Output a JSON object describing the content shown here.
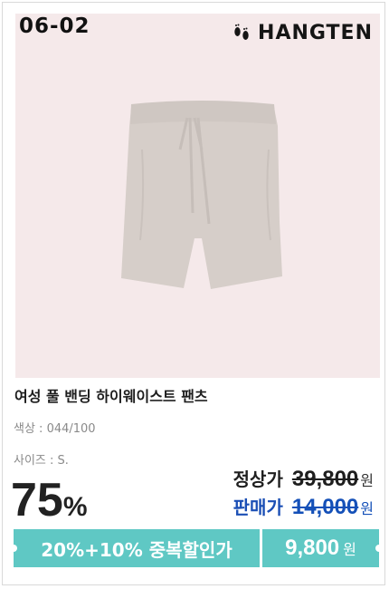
{
  "badge": {
    "code": "06-02"
  },
  "brand": {
    "name": "HANGTEN",
    "icon": "footprints-icon"
  },
  "product": {
    "title": "여성 풀 밴딩 하이웨이스트 팬츠",
    "color_label": "색상 : 044/100",
    "size_label": "사이즈 : S."
  },
  "discount": {
    "percent": "75",
    "symbol": "%"
  },
  "pricing": {
    "regular_label": "정상가",
    "regular_price": "39,800",
    "sale_label": "판매가",
    "sale_price": "14,000",
    "currency": "원"
  },
  "coupon": {
    "banner_text": "20%+10% 중복할인가",
    "final_price": "9,800",
    "currency": "원"
  },
  "colors": {
    "accent": "#5fc8c4",
    "sale_blue": "#1450b8",
    "photo_bg": "#f5e9ea"
  }
}
